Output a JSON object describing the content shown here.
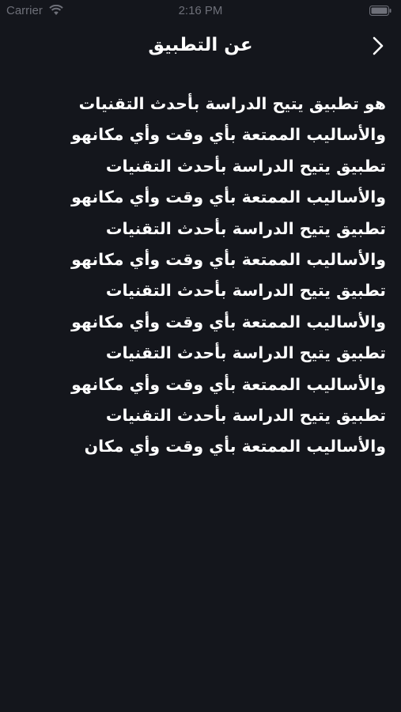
{
  "status_bar": {
    "carrier": "Carrier",
    "time": "2:16 PM",
    "wifi_icon": "wifi-icon",
    "battery_icon": "battery-icon"
  },
  "nav": {
    "title": "عن التطبيق",
    "back_icon": "chevron-right-icon"
  },
  "about": {
    "text": "هو تطبيق يتيح الدراسة بأحدث التقنيات والأساليب الممتعة بأي وقت وأي مكانهو تطبيق يتيح الدراسة بأحدث التقنيات والأساليب الممتعة بأي وقت وأي مكانهو تطبيق يتيح الدراسة بأحدث التقنيات والأساليب الممتعة بأي وقت وأي مكانهو تطبيق يتيح الدراسة بأحدث التقنيات والأساليب الممتعة بأي وقت وأي مكانهو تطبيق يتيح الدراسة بأحدث التقنيات والأساليب الممتعة بأي وقت وأي مكانهو تطبيق يتيح الدراسة بأحدث التقنيات والأساليب الممتعة بأي وقت وأي مكان"
  },
  "colors": {
    "background": "#14161c",
    "text": "#ffffff",
    "status_text": "#6e7079"
  }
}
